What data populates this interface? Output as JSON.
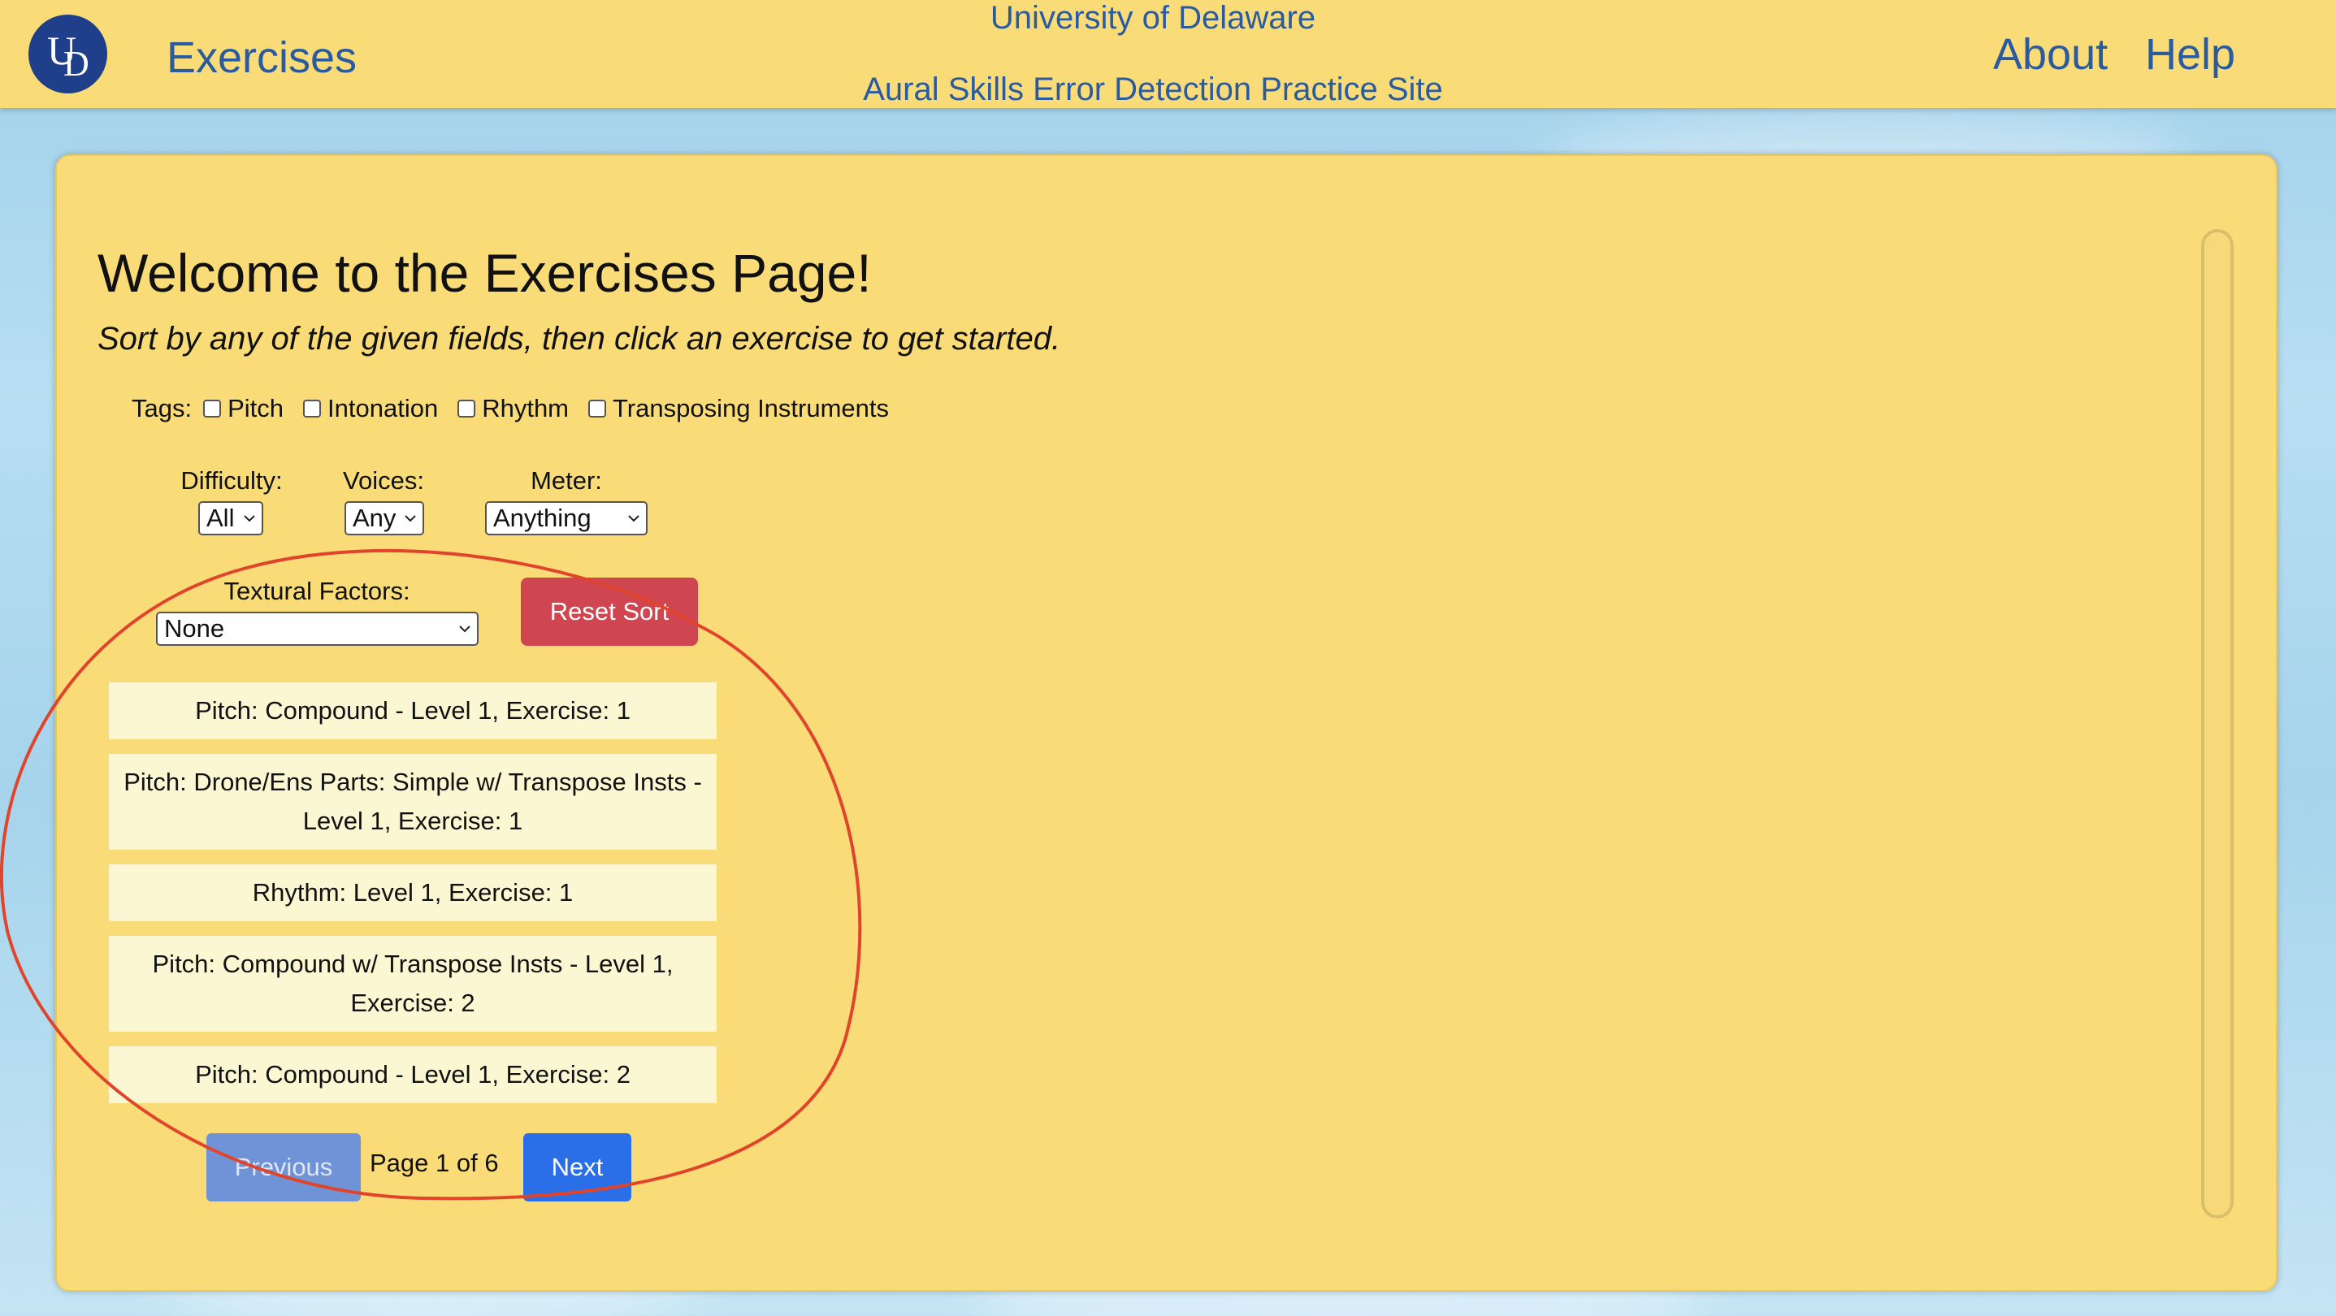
{
  "header": {
    "brand": "Exercises",
    "center_line1": "University of Delaware",
    "center_line2": "Aural Skills Error Detection Practice Site",
    "links": [
      "About",
      "Help"
    ]
  },
  "main": {
    "title": "Welcome to the Exercises Page!",
    "subtitle": "Sort by any of the given fields, then click an exercise to get started.",
    "tags_label": "Tags:",
    "tags": [
      "Pitch",
      "Intonation",
      "Rhythm",
      "Transposing Instruments"
    ],
    "difficulty": {
      "label": "Difficulty:",
      "value": "All"
    },
    "voices": {
      "label": "Voices:",
      "value": "Any"
    },
    "meter": {
      "label": "Meter:",
      "value": "Anything"
    },
    "textural": {
      "label": "Textural Factors:",
      "value": "None"
    },
    "reset_label": "Reset Sort",
    "exercises": [
      "Pitch: Compound - Level 1, Exercise: 1",
      "Pitch: Drone/Ens Parts: Simple w/ Transpose Insts - Level 1, Exercise: 1",
      "Rhythm: Level 1, Exercise: 1",
      "Pitch: Compound w/ Transpose Insts - Level 1, Exercise: 2",
      "Pitch: Compound - Level 1, Exercise: 2"
    ],
    "pagination": {
      "previous": "Previous",
      "indicator": "Page 1 of 6",
      "next": "Next"
    }
  },
  "colors": {
    "navbar": "#f9dc78",
    "card": "#f9dc78",
    "link": "#2a5b9f",
    "reset_button": "#cf4550",
    "next_button": "#2a6ee8",
    "previous_button_disabled": "#6f93d6",
    "annotation_circle": "#e0452c"
  },
  "icons": {
    "logo": "ud-logo",
    "select_arrow": "chevron-down-icon"
  }
}
